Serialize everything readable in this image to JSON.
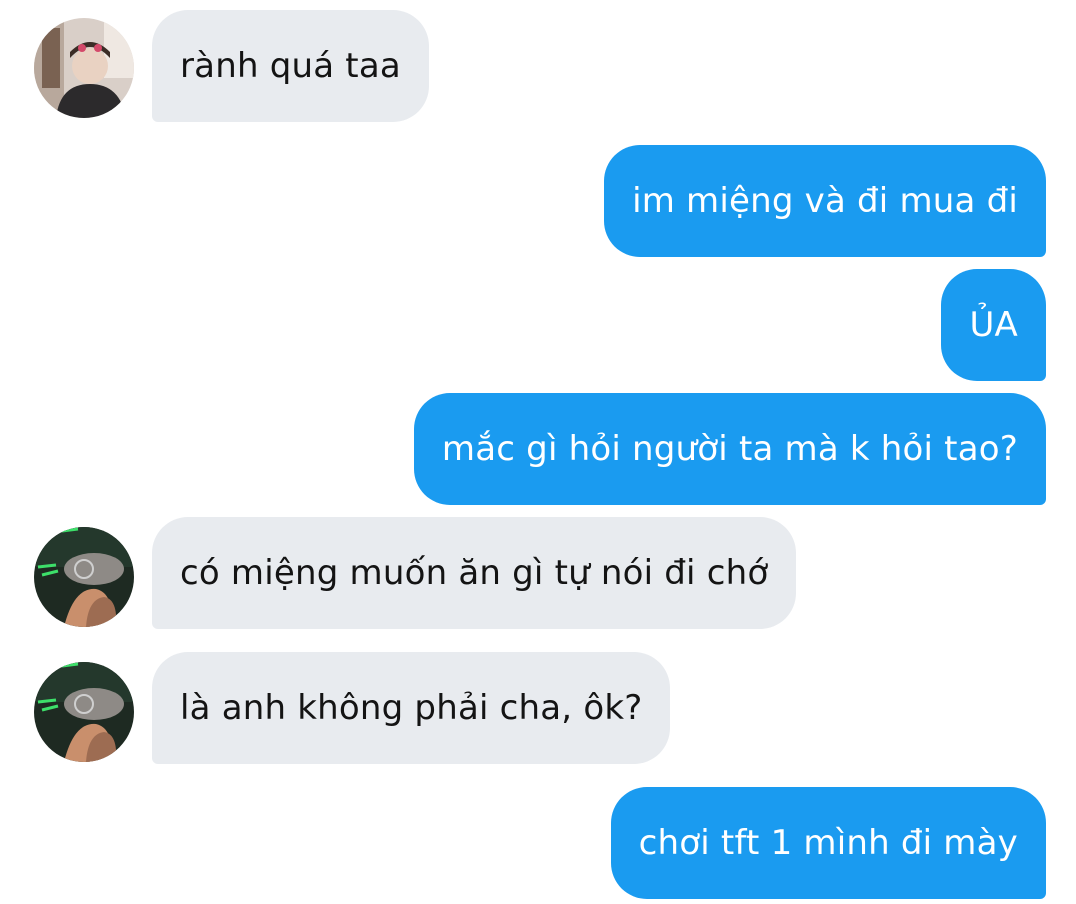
{
  "conversation": {
    "messages": [
      {
        "direction": "incoming",
        "text": "rành quá taa",
        "avatar": "avatar-photo-1"
      },
      {
        "direction": "outgoing",
        "text": "im miệng và đi mua đi"
      },
      {
        "direction": "outgoing",
        "text": "ỦA"
      },
      {
        "direction": "outgoing",
        "text": "mắc gì hỏi người ta mà k hỏi tao?"
      },
      {
        "direction": "incoming",
        "text": "có miệng muốn ăn gì tự nói đi chớ",
        "avatar": "avatar-photo-2"
      },
      {
        "direction": "incoming",
        "text": "là anh không phải cha, ôk?",
        "avatar": "avatar-photo-2"
      },
      {
        "direction": "outgoing",
        "text": "chơi tft 1 mình đi mày"
      }
    ]
  },
  "colors": {
    "incoming_bubble": "#e8ebef",
    "outgoing_bubble": "#1a9bf0",
    "incoming_text": "#141414",
    "outgoing_text": "#ffffff"
  }
}
